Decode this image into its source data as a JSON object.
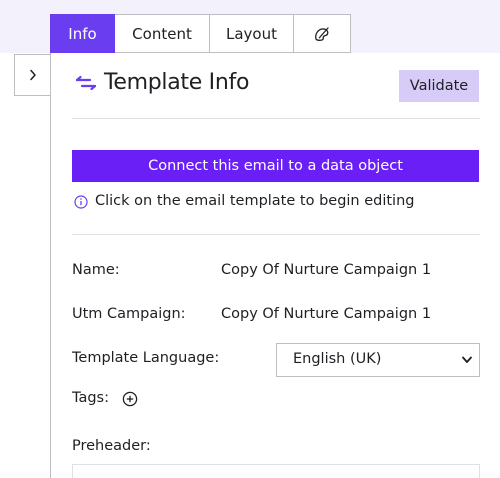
{
  "tabs": [
    {
      "label": "Info",
      "active": true
    },
    {
      "label": "Content",
      "active": false
    },
    {
      "label": "Layout",
      "active": false
    },
    {
      "label": "",
      "icon": "palette-icon",
      "active": false
    }
  ],
  "sidebar": {
    "collapse_icon": "chevron-right-icon"
  },
  "header": {
    "icon": "swap-arrows-icon",
    "title": "Template Info",
    "validate_label": "Validate"
  },
  "connect": {
    "label": "Connect this email to a data object"
  },
  "hint": {
    "icon": "info-icon",
    "text": "Click on the email template to begin editing"
  },
  "fields": {
    "name": {
      "label": "Name:",
      "value": "Copy Of Nurture Campaign 1"
    },
    "utm_campaign": {
      "label": "Utm Campaign:",
      "value": "Copy Of Nurture Campaign 1"
    },
    "template_language": {
      "label": "Template Language:",
      "selected": "English (UK)"
    },
    "tags": {
      "label": "Tags:",
      "add_icon": "plus-circle-icon"
    },
    "preheader": {
      "label": "Preheader:",
      "value": ""
    }
  },
  "colors": {
    "accent": "#6a3df0",
    "connect_button": "#6a1ff7",
    "validate_button": "#d7ccf8",
    "top_band": "#f3f1fb"
  }
}
